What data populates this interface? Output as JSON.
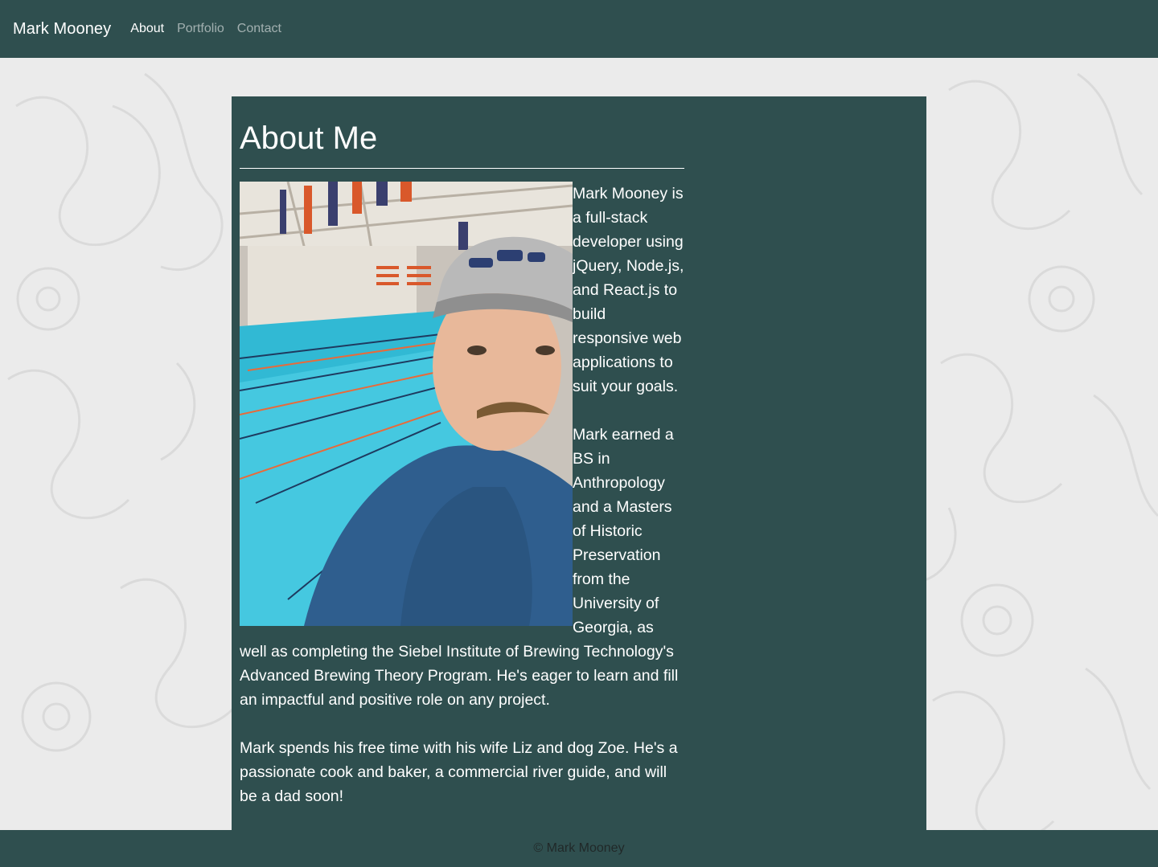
{
  "navbar": {
    "brand": "Mark Mooney",
    "links": [
      {
        "label": "About",
        "active": true
      },
      {
        "label": "Portfolio",
        "active": false
      },
      {
        "label": "Contact",
        "active": false
      }
    ]
  },
  "main": {
    "title": "About Me",
    "paragraphs": [
      "Mark Mooney is a full-stack developer using jQuery, Node.js, and React.js to build responsive web applications to suit your goals.",
      "Mark earned a BS in Anthropology and a Masters of Historic Preservation from the University of Georgia, as well as completing the Siebel Institute of Brewing Technology's Advanced Brewing Theory Program. He's eager to learn and fill an impactful and positive role on any project.",
      "Mark spends his free time with his wife Liz and dog Zoe. He's a passionate cook and baker, a commercial river guide, and will be a dad soon!"
    ]
  },
  "footer": {
    "text": "© Mark Mooney"
  },
  "colors": {
    "primary": "#2f4f4f",
    "background": "#ebebeb",
    "text_light": "#ffffff"
  }
}
